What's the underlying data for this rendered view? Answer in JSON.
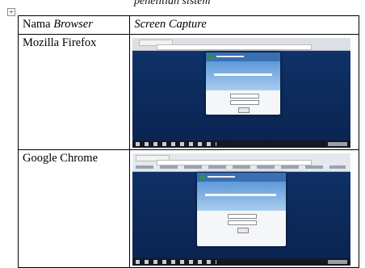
{
  "top_crop_text": "penelitian sistem",
  "table": {
    "header": {
      "col1_prefix": "Nama ",
      "col1_em": "Browser",
      "col2": "Screen Capture"
    },
    "rows": [
      {
        "browser": "Mozilla Firefox"
      },
      {
        "browser": "Google Chrome"
      }
    ]
  },
  "screenshots": {
    "background": "#0c2b5c",
    "accent": "#3a6fb4"
  }
}
